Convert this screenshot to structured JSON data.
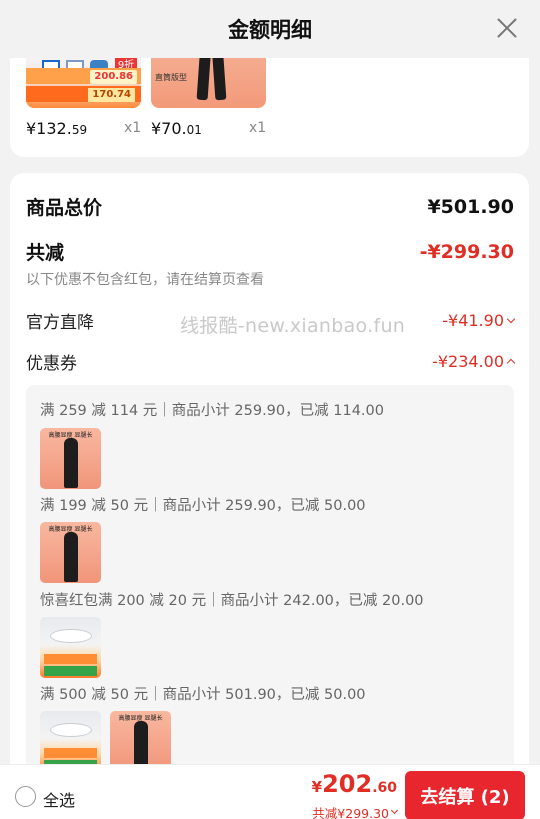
{
  "header": {
    "title": "金额明细",
    "close_icon": "close-icon"
  },
  "products": [
    {
      "price_main": "¥132.",
      "price_decimal": "59",
      "qty": "x1",
      "thumb_chip": "200.86",
      "thumb_chip2": "170.74",
      "thumb_tag": "9折"
    },
    {
      "price_main": "¥70.",
      "price_decimal": "01",
      "qty": "x1",
      "thumb_caption": "直筒版型"
    }
  ],
  "summary": {
    "goods_total_label": "商品总价",
    "goods_total_value": "¥501.90",
    "discount_label": "共减",
    "discount_value": "-¥299.30",
    "discount_note": "以下优惠不包含红包，请在结算页查看",
    "official_label": "官方直降",
    "official_value": "-¥41.90",
    "coupon_label": "优惠券",
    "coupon_value": "-¥234.00"
  },
  "watermark": "线报酷-new.xianbao.fun",
  "coupon_details": [
    "满 259 减 114 元｜商品小计 259.90，已减 114.00",
    "满 199 减 50 元｜商品小计 259.90，已减 50.00",
    "惊喜红包满 200 减 20 元｜商品小计 242.00，已减 20.00",
    "满 500 减 50 元｜商品小计 501.90，已减 50.00"
  ],
  "thumb_header": "高腰显瘦 显腿长",
  "bottom": {
    "select_all": "全选",
    "price_currency": "¥",
    "price_int": "202",
    "price_dec": ".60",
    "saved": "共减¥299.30",
    "checkout": "去结算 (2)"
  },
  "colors": {
    "accent": "#e02e24",
    "button": "#e8262d"
  }
}
